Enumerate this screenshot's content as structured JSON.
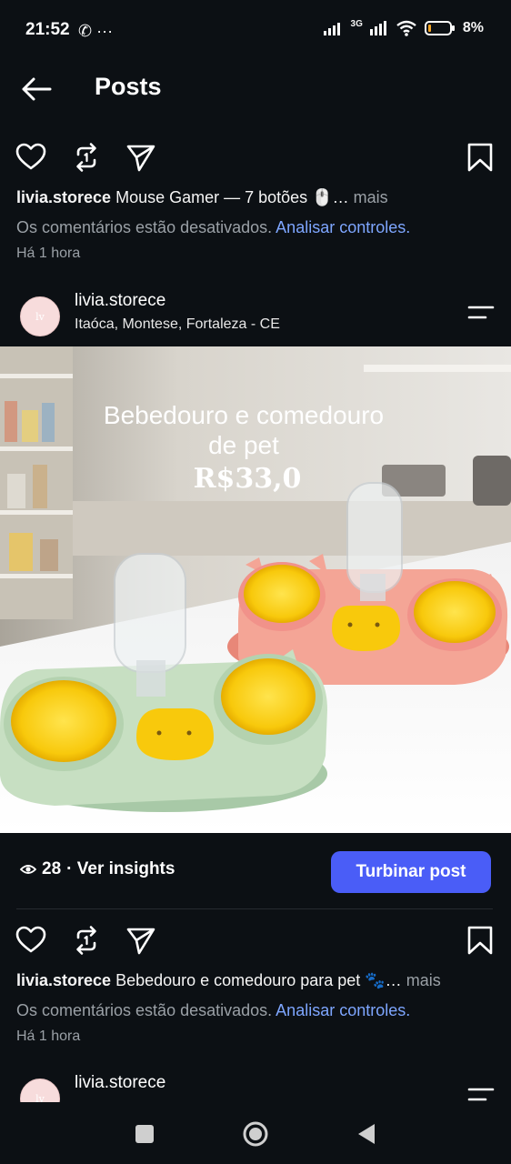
{
  "status_bar": {
    "time": "21:52",
    "left_icons": "✆ ···",
    "network": "3G",
    "battery": "8%"
  },
  "header": {
    "title": "Posts"
  },
  "post1": {
    "username": "livia.storece",
    "caption": "Mouse Gamer — 7 botões 🖱️…",
    "more": "mais",
    "comments_off": "Os comentários estão desativados.",
    "analyze_link": "Analisar controles.",
    "time_ago": "Há 1 hora"
  },
  "post2": {
    "username": "livia.storece",
    "location": "Itaóca, Montese, Fortaleza - CE",
    "avatar_text": "lv",
    "image_title_line1": "Bebedouro e comedouro",
    "image_title_line2": "de pet",
    "image_price": "R$33,0",
    "views": "28",
    "insights_label": "· Ver insights",
    "boost_label": "Turbinar post",
    "caption": "Bebedouro e comedouro para pet 🐾…",
    "more": "mais",
    "comments_off": "Os comentários estão desativados.",
    "analyze_link": "Analisar controles.",
    "time_ago": "Há 1 hora"
  },
  "post3": {
    "username": "livia.storece",
    "avatar_text": "lv"
  },
  "colors": {
    "background": "#0c1014",
    "accent": "#4a5df7",
    "link": "#7ea6ff"
  }
}
